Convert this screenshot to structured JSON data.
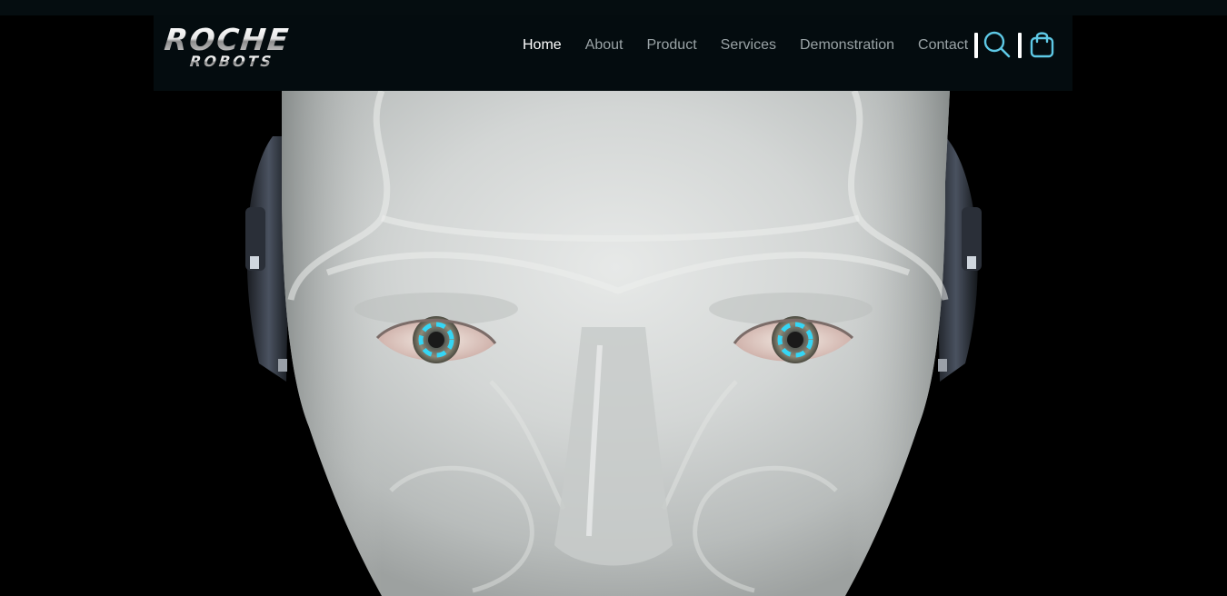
{
  "brand": {
    "logo_line1": "ROCHE",
    "logo_line2": "ROBOTS"
  },
  "nav": {
    "items": [
      {
        "label": "Home",
        "active": true
      },
      {
        "label": "About",
        "active": false
      },
      {
        "label": "Product",
        "active": false
      },
      {
        "label": "Services",
        "active": false
      },
      {
        "label": "Demonstration",
        "active": false
      },
      {
        "label": "Contact",
        "active": false
      }
    ],
    "search_icon": "search-icon",
    "cart_icon": "shopping-bag-icon"
  },
  "colors": {
    "page_background": "#000000",
    "navbar_background": "#040c0f",
    "nav_text": "#9aa3a6",
    "nav_text_active": "#ffffff",
    "icon_accent": "#5ec9e6",
    "robot_eye_glow": "#35d6f5",
    "robot_skin": "#d6d9d8"
  },
  "hero": {
    "image": "robot-face"
  }
}
